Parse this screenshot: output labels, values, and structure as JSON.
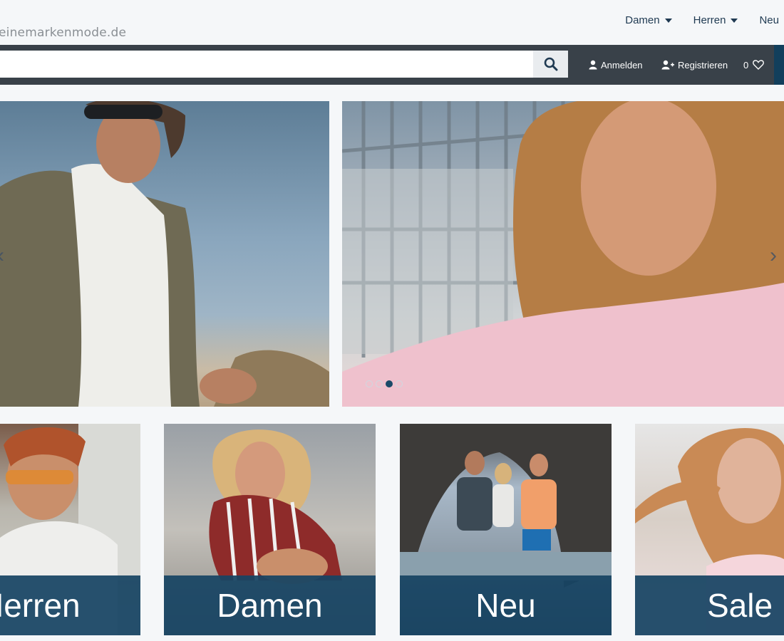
{
  "header": {
    "logo_text": "einemarkenmode.de",
    "nav": [
      {
        "label": "Damen",
        "has_dropdown": true
      },
      {
        "label": "Herren",
        "has_dropdown": true
      },
      {
        "label": "Neu",
        "has_dropdown": false
      }
    ]
  },
  "searchbar": {
    "search_value": "",
    "search_icon": "search-icon",
    "login_label": "Anmelden",
    "login_icon": "user-icon",
    "register_label": "Registrieren",
    "register_icon": "user-plus-icon",
    "wishlist_count": "0",
    "wishlist_icon": "heart-icon"
  },
  "slider": {
    "slide_count": 4,
    "active_slide_index": 3
  },
  "categories": [
    {
      "label": "Herren"
    },
    {
      "label": "Damen"
    },
    {
      "label": "Neu"
    },
    {
      "label": "Sale"
    }
  ],
  "colors": {
    "header_bar": "#394149",
    "accent": "#174463",
    "nav_text": "#1f3a52"
  }
}
